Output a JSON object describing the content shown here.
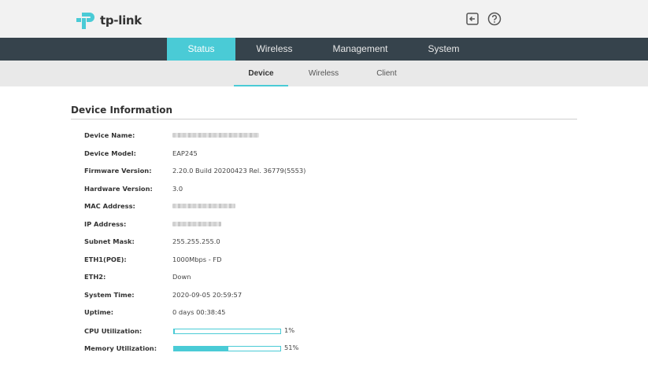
{
  "brand": {
    "logo_text": "tp-link",
    "accent": "#4acbd6",
    "nav_bg": "#36434c"
  },
  "header_icons": [
    {
      "name": "logout-icon"
    },
    {
      "name": "help-icon"
    }
  ],
  "main_nav": {
    "tabs": [
      {
        "label": "Status",
        "active": true
      },
      {
        "label": "Wireless",
        "active": false
      },
      {
        "label": "Management",
        "active": false
      },
      {
        "label": "System",
        "active": false
      }
    ]
  },
  "sub_nav": {
    "tabs": [
      {
        "label": "Device",
        "active": true
      },
      {
        "label": "Wireless",
        "active": false
      },
      {
        "label": "Client",
        "active": false
      }
    ]
  },
  "device_info": {
    "title": "Device Information",
    "rows": [
      {
        "label": "Device Name:",
        "value": "",
        "redacted": true
      },
      {
        "label": "Device Model:",
        "value": "EAP245"
      },
      {
        "label": "Firmware Version:",
        "value": "2.20.0 Build 20200423 Rel. 36779(5553)"
      },
      {
        "label": "Hardware Version:",
        "value": "3.0"
      },
      {
        "label": "MAC Address:",
        "value": "",
        "redacted": true
      },
      {
        "label": "IP Address:",
        "value": "",
        "redacted": true
      },
      {
        "label": "Subnet Mask:",
        "value": "255.255.255.0"
      },
      {
        "label": "ETH1(POE):",
        "value": "1000Mbps - FD"
      },
      {
        "label": "ETH2:",
        "value": "Down"
      },
      {
        "label": "System Time:",
        "value": "2020-09-05 20:59:57"
      },
      {
        "label": "Uptime:",
        "value": "0 days 00:38:45"
      }
    ],
    "cpu": {
      "label": "CPU Utilization:",
      "percent_text": "1%",
      "fraction": 0.01
    },
    "memory": {
      "label": "Memory Utilization:",
      "percent_text": "51%",
      "fraction": 0.51
    }
  }
}
